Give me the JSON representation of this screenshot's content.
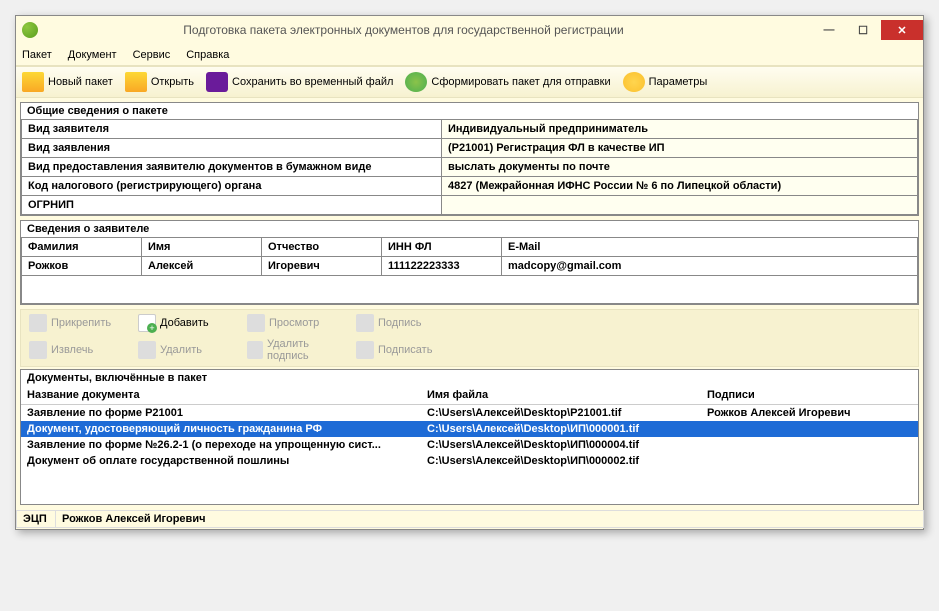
{
  "window": {
    "title": "Подготовка пакета электронных документов для государственной регистрации"
  },
  "menu": {
    "packet": "Пакет",
    "document": "Документ",
    "service": "Сервис",
    "help": "Справка"
  },
  "toolbar": {
    "new_packet": "Новый пакет",
    "open": "Открыть",
    "save_temp": "Сохранить во временный файл",
    "form_packet": "Сформировать пакет для отправки",
    "params": "Параметры"
  },
  "general": {
    "title": "Общие сведения о пакете",
    "rows": [
      {
        "label": "Вид заявителя",
        "value": "Индивидуальный предприниматель"
      },
      {
        "label": "Вид заявления",
        "value": "(Р21001) Регистрация ФЛ в качестве ИП"
      },
      {
        "label": "Вид предоставления заявителю документов в бумажном виде",
        "value": "выслать документы по почте"
      },
      {
        "label": "Код налогового (регистрирующего) органа",
        "value": "4827 (Межрайонная ИФНС России № 6 по Липецкой области)"
      },
      {
        "label": "ОГРНИП",
        "value": ""
      }
    ]
  },
  "applicant": {
    "title": "Сведения о заявителе",
    "headers": {
      "lastname": "Фамилия",
      "firstname": "Имя",
      "middlename": "Отчество",
      "inn": "ИНН ФЛ",
      "email": "E-Mail"
    },
    "row": {
      "lastname": "Рожков",
      "firstname": "Алексей",
      "middlename": "Игоревич",
      "inn": "111122223333",
      "email": "madcopy@gmail.com"
    }
  },
  "subtoolbar": {
    "attach": "Прикрепить",
    "add": "Добавить",
    "view": "Просмотр",
    "sign": "Подпись",
    "extract": "Извлечь",
    "delete": "Удалить",
    "del_sign": "Удалить подпись",
    "do_sign": "Подписать"
  },
  "documents": {
    "title": "Документы, включённые в пакет",
    "headers": {
      "name": "Название документа",
      "file": "Имя файла",
      "sign": "Подписи"
    },
    "rows": [
      {
        "name": "Заявление по форме Р21001",
        "file": "C:\\Users\\Алексей\\Desktop\\P21001.tif",
        "sign": "Рожков Алексей Игоревич",
        "selected": false
      },
      {
        "name": "Документ, удостоверяющий личность гражданина РФ",
        "file": "C:\\Users\\Алексей\\Desktop\\ИП\\000001.tif",
        "sign": "",
        "selected": true
      },
      {
        "name": "Заявление по форме №26.2-1 (о переходе на упрощенную сист...",
        "file": "C:\\Users\\Алексей\\Desktop\\ИП\\000004.tif",
        "sign": "",
        "selected": false
      },
      {
        "name": "Документ об оплате государственной пошлины",
        "file": "C:\\Users\\Алексей\\Desktop\\ИП\\000002.tif",
        "sign": "",
        "selected": false
      }
    ]
  },
  "statusbar": {
    "eds": "ЭЦП",
    "name": "Рожков Алексей Игоревич"
  }
}
